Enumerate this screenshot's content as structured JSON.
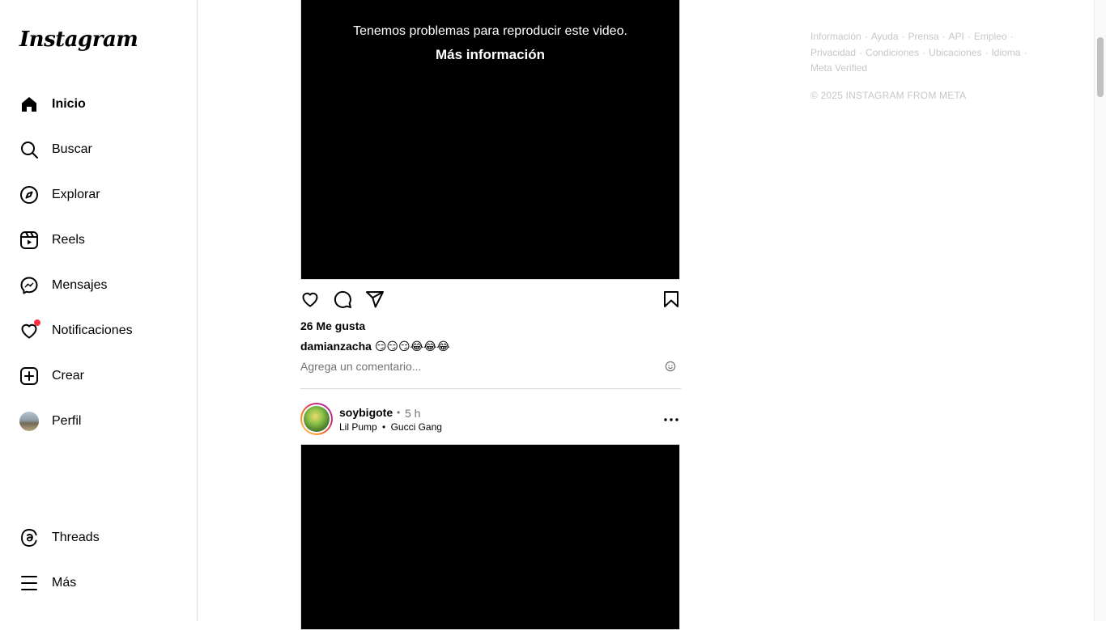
{
  "sidebar": {
    "logo": "Instagram",
    "items": [
      {
        "label": "Inicio"
      },
      {
        "label": "Buscar"
      },
      {
        "label": "Explorar"
      },
      {
        "label": "Reels"
      },
      {
        "label": "Mensajes"
      },
      {
        "label": "Notificaciones"
      },
      {
        "label": "Crear"
      },
      {
        "label": "Perfil"
      }
    ],
    "bottom": [
      {
        "label": "Threads"
      },
      {
        "label": "Más"
      }
    ]
  },
  "post1": {
    "video_error": "Tenemos problemas para reproducir este video.",
    "video_more": "Más información",
    "likes": "26 Me gusta",
    "caption_user": "damianzacha",
    "caption_text": "😏😏😏😂😂😂",
    "comment_placeholder": "Agrega un comentario..."
  },
  "post2": {
    "username": "soybigote",
    "separator": "•",
    "time": "5 h",
    "audio_artist": "Lil Pump",
    "audio_separator": "•",
    "audio_title": "Gucci Gang"
  },
  "footer": {
    "links": [
      "Información",
      "Ayuda",
      "Prensa",
      "API",
      "Empleo",
      "Privacidad",
      "Condiciones",
      "Ubicaciones",
      "Idioma",
      "Meta Verified"
    ],
    "copyright": "© 2025 INSTAGRAM FROM META"
  },
  "colors": {
    "notification_dot": "#ff3040",
    "muted_text": "#737373",
    "footer_text": "#c7c7c7",
    "border": "#dbdbdb"
  }
}
